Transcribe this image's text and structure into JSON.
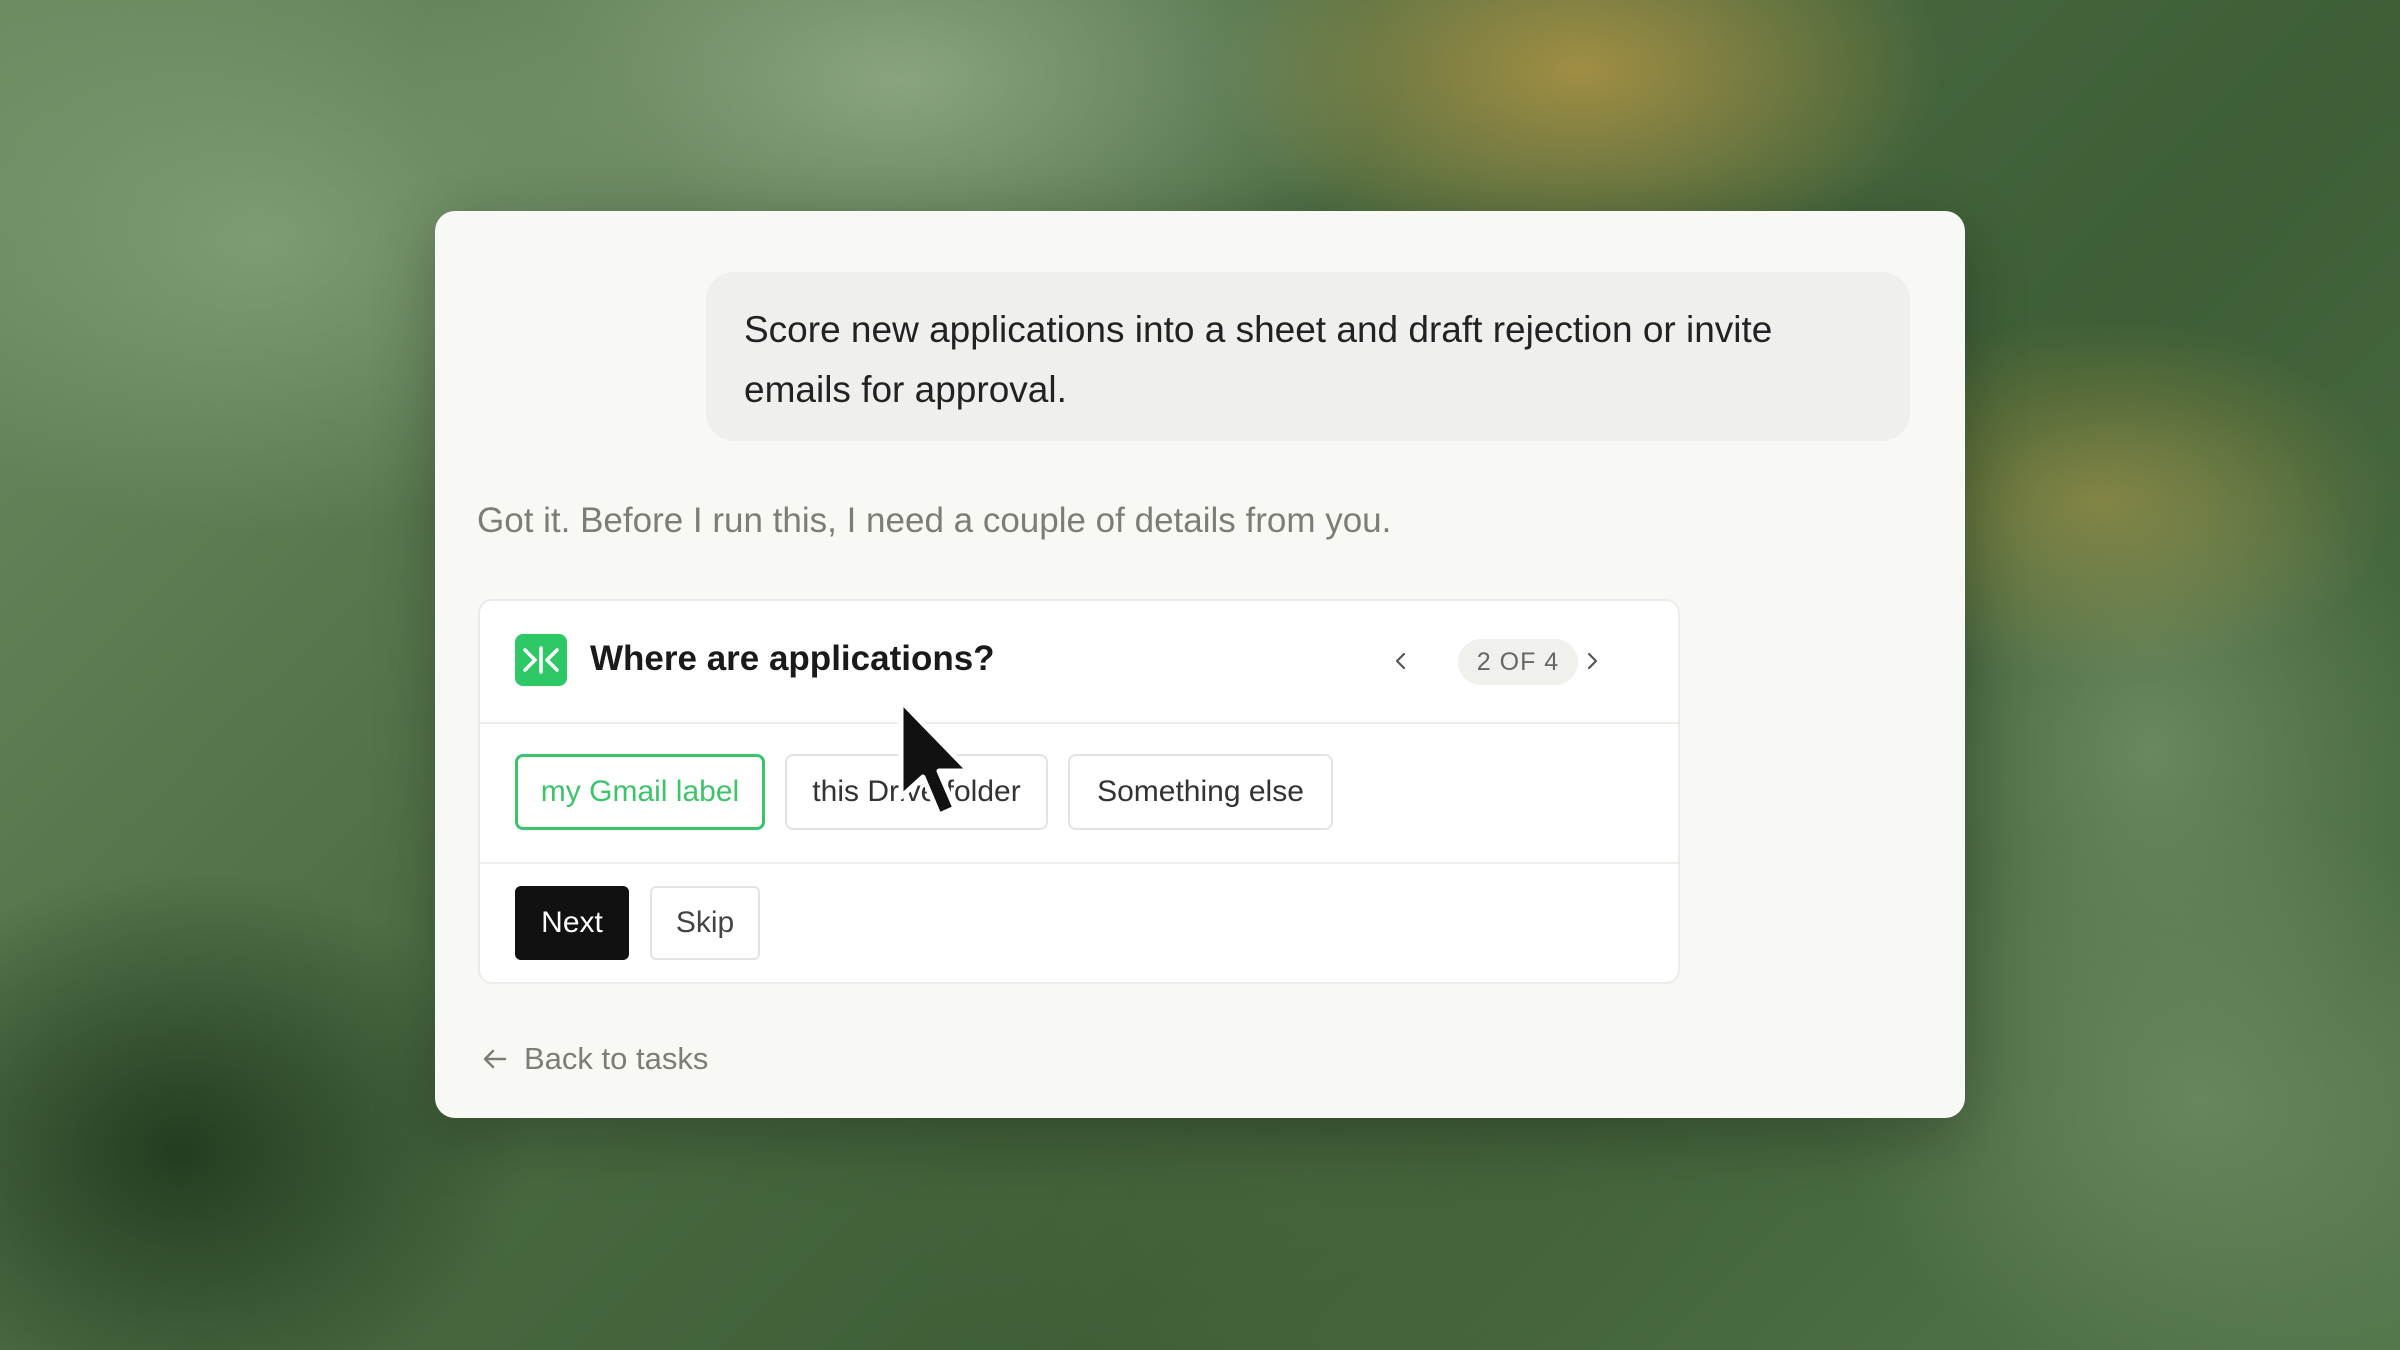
{
  "conversation": {
    "user_message": "Score new applications into a sheet and draft rejection or invite emails for approval.",
    "assistant_message": "Got it. Before I run this, I need a couple of details from you."
  },
  "question": {
    "app_icon": "agent-logo-icon",
    "title": "Where are applications?",
    "pager": {
      "label": "2 OF 4",
      "prev_icon": "chevron-left-icon",
      "next_icon": "chevron-right-icon"
    },
    "options": [
      {
        "label": "my Gmail label",
        "selected": true
      },
      {
        "label": "this Drive folder",
        "selected": false
      },
      {
        "label": "Something else",
        "selected": false
      }
    ],
    "actions": {
      "next_label": "Next",
      "skip_label": "Skip"
    }
  },
  "footer": {
    "back_label": "Back to tasks",
    "back_icon": "arrow-left-icon"
  },
  "colors": {
    "accent": "#3cc46a",
    "primary_button": "#111111",
    "card_background": "#f8f8f5"
  }
}
